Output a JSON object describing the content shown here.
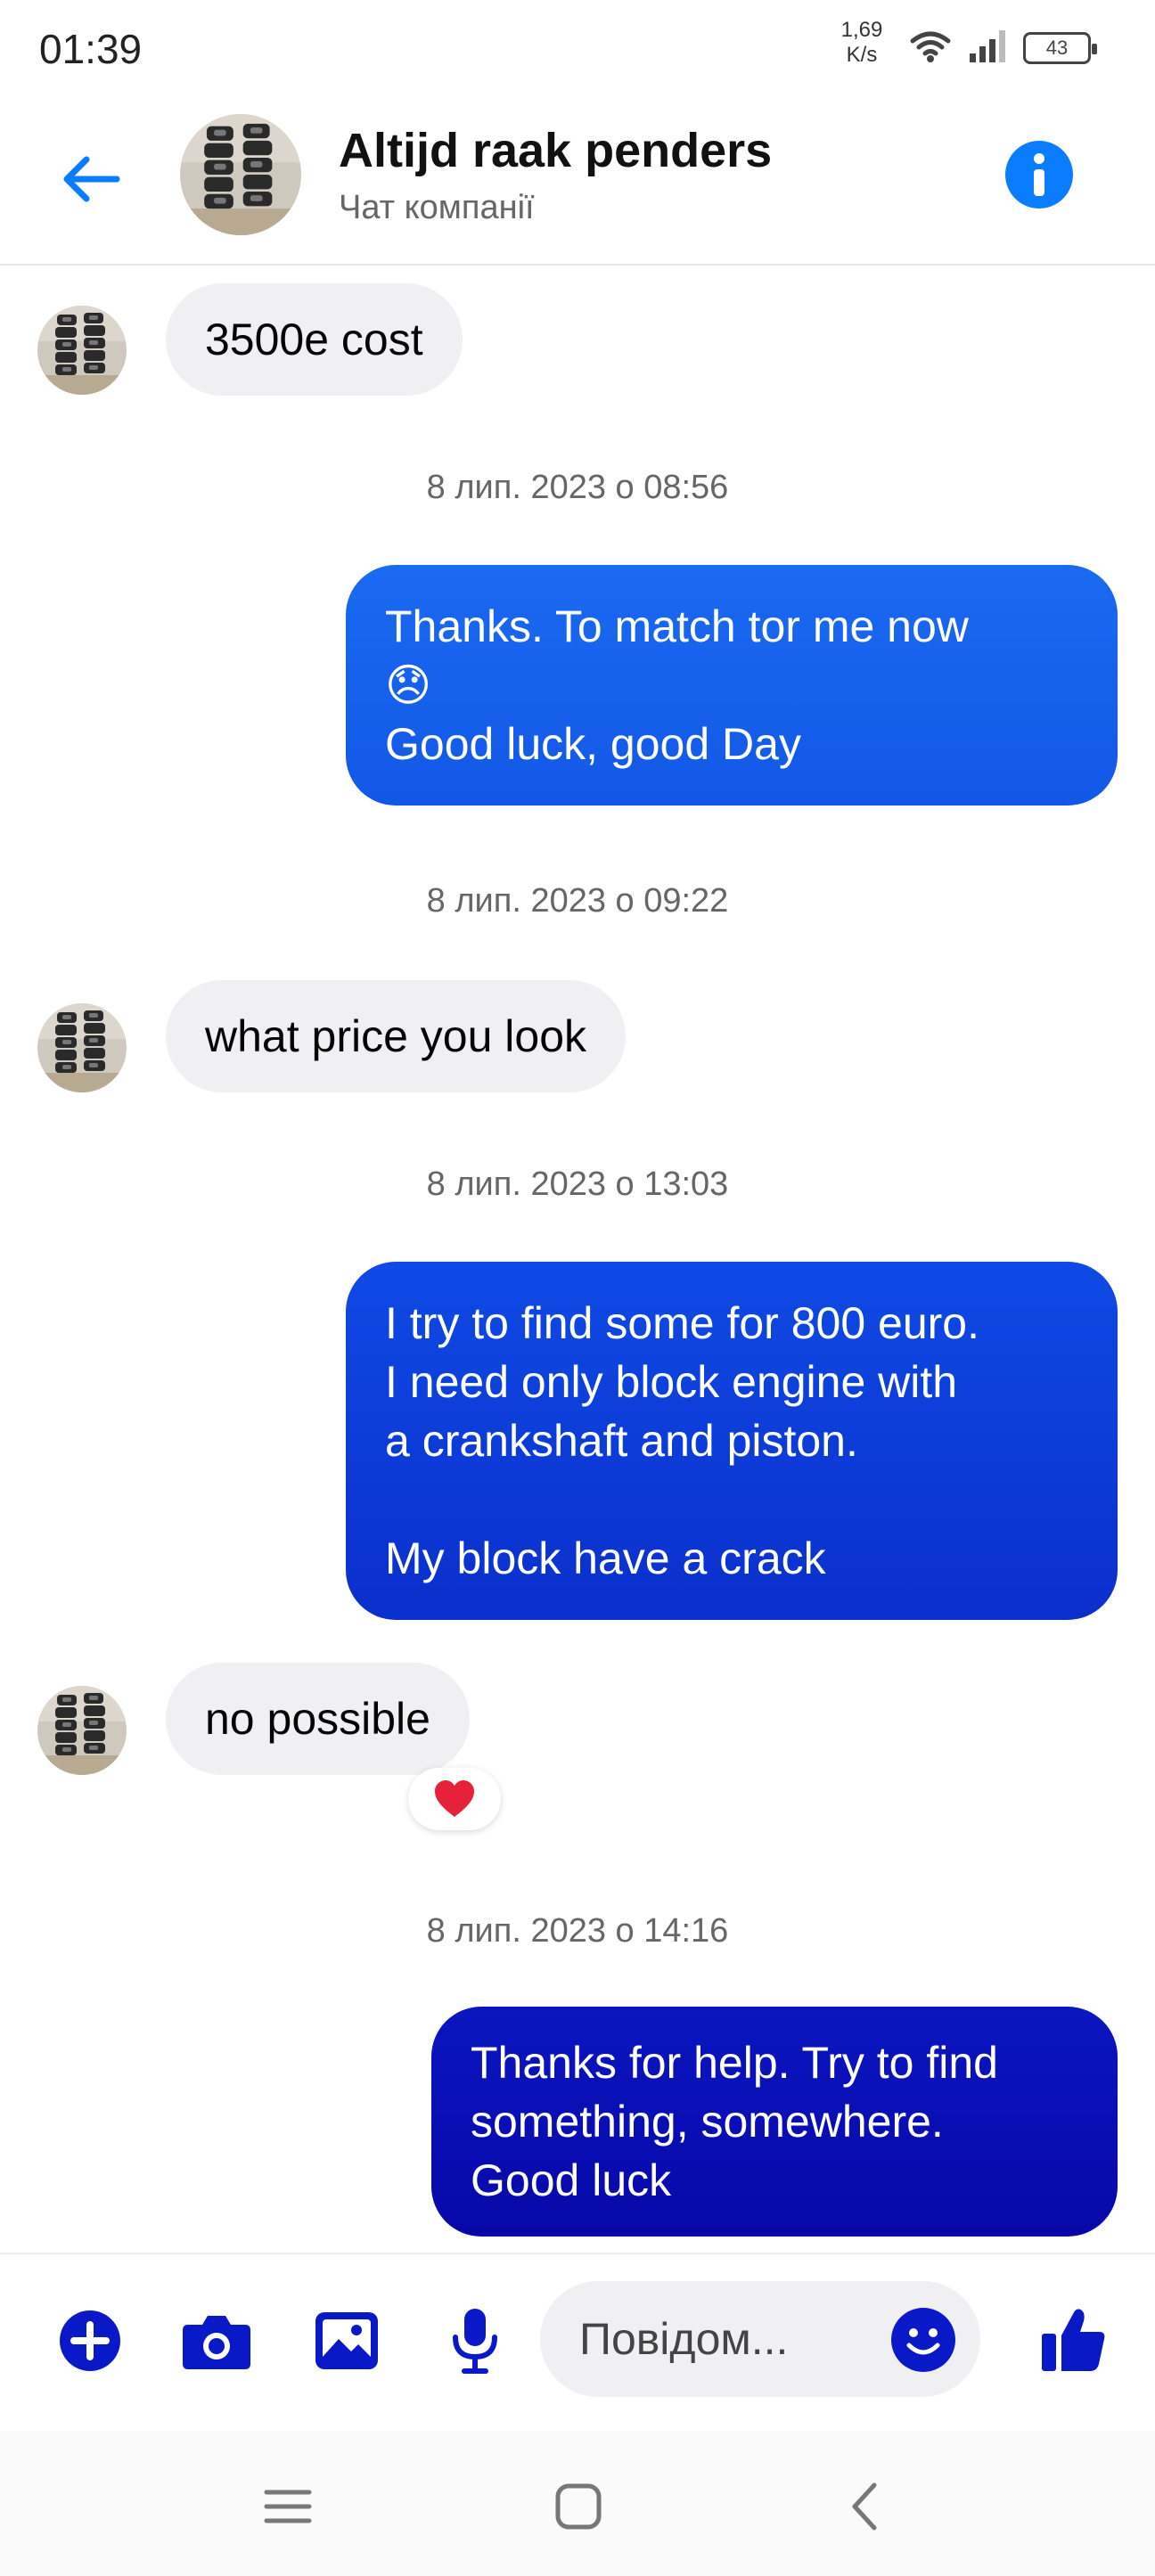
{
  "status_bar": {
    "time": "01:39",
    "net_speed_value": "1,69",
    "net_speed_unit": "K/s",
    "battery": "43"
  },
  "header": {
    "title": "Altijd raak penders",
    "subtitle": "Чат компанії"
  },
  "messages": [
    {
      "type": "in",
      "text": "3500e cost"
    },
    {
      "type": "timestamp",
      "text": "8 лип. 2023 о 08:56"
    },
    {
      "type": "out",
      "lines": [
        "Thanks. To match tor me now",
        "😞",
        "Good luck, good Day"
      ]
    },
    {
      "type": "timestamp",
      "text": "8 лип. 2023 о 09:22"
    },
    {
      "type": "in",
      "text": "what price you look"
    },
    {
      "type": "timestamp",
      "text": "8 лип. 2023 о 13:03"
    },
    {
      "type": "out",
      "lines": [
        "I try to find some for 800 euro.",
        "I need only block engine with",
        "a crankshaft and piston.",
        "",
        "My block have a crack"
      ]
    },
    {
      "type": "in",
      "text": "no possible",
      "reaction": "heart"
    },
    {
      "type": "timestamp",
      "text": "8 лип. 2023 о 14:16"
    },
    {
      "type": "out",
      "lines": [
        "Thanks for help. Try to find",
        "something, somewhere.",
        "Good luck"
      ]
    }
  ],
  "composer": {
    "placeholder": "Повідом..."
  },
  "colors": {
    "accent": "#0a7cff",
    "bubble_in": "#f0f0f2",
    "bubble_out_top": "#1565f0",
    "bubble_out_bottom": "#0a0ab0",
    "composer_icon": "#0a19c8"
  },
  "icons": {
    "back": "arrow-left-icon",
    "info": "info-icon",
    "add": "plus-circle-icon",
    "camera": "camera-icon",
    "gallery": "image-icon",
    "mic": "microphone-icon",
    "emoji": "smiley-icon",
    "like": "thumbs-up-icon",
    "nav_menu": "menu-icon",
    "nav_home": "home-square-icon",
    "nav_back": "chevron-left-icon"
  }
}
